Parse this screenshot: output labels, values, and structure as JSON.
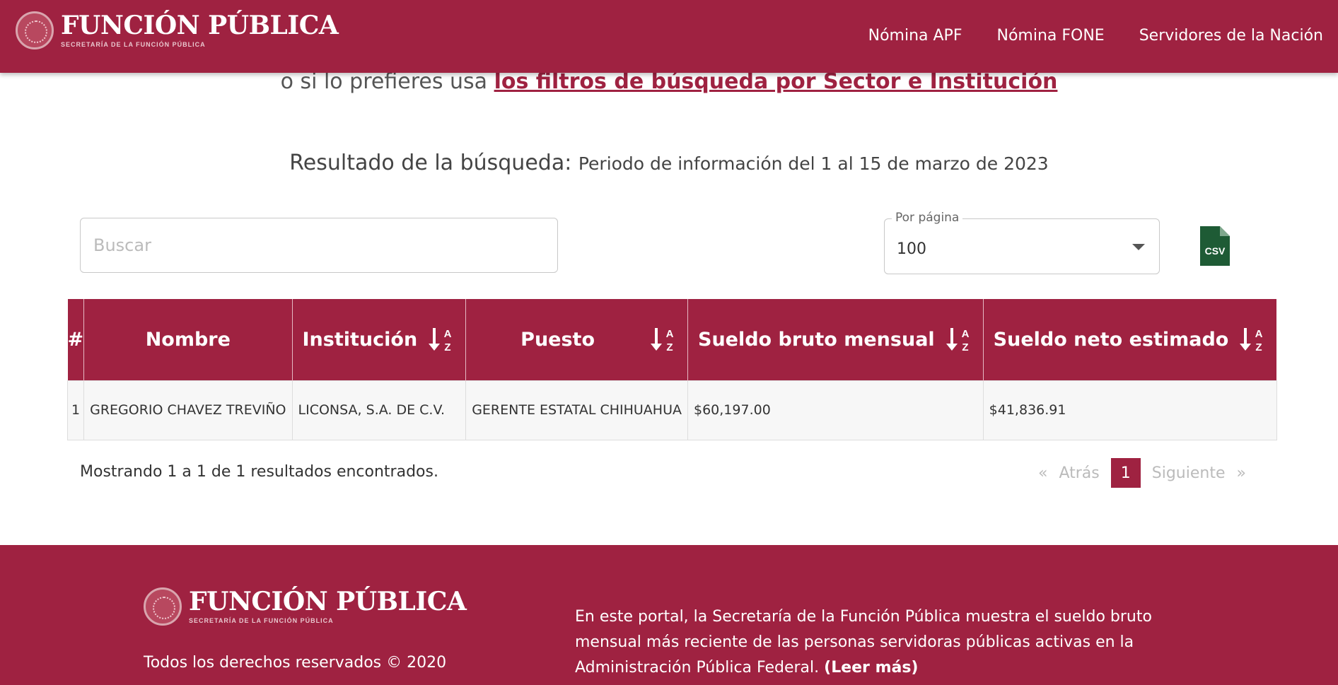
{
  "header": {
    "brand_title": "FUNCIÓN PÚBLICA",
    "brand_subtitle": "SECRETARÍA DE LA FUNCIÓN PÚBLICA",
    "nav": [
      "Nómina APF",
      "Nómina FONE",
      "Servidores de la Nación"
    ]
  },
  "main": {
    "alt_prefix": "o si lo prefieres usa ",
    "alt_link": "los filtros de búsqueda por Sector e Institución",
    "result_label": "Resultado de la búsqueda: ",
    "result_period": "Periodo de información del 1 al 15 de marzo de 2023",
    "search_placeholder": "Buscar",
    "search_value": "",
    "per_page_label": "Por página",
    "per_page_value": "100",
    "csv_icon_text": "CSV"
  },
  "table": {
    "headers": [
      "#",
      "Nombre",
      "Institución",
      "Puesto",
      "Sueldo bruto mensual",
      "Sueldo neto estimado"
    ],
    "rows": [
      [
        "1",
        "GREGORIO CHAVEZ TREVIÑO",
        "LICONSA, S.A. DE C.V.",
        "GERENTE ESTATAL CHIHUAHUA",
        "$60,197.00",
        "$41,836.91"
      ]
    ]
  },
  "pagination": {
    "summary": "Mostrando 1 a 1 de 1 resultados encontrados.",
    "first": "«",
    "prev": "Atrás",
    "current": "1",
    "next": "Siguiente",
    "last": "»"
  },
  "footer": {
    "brand_title": "FUNCIÓN PÚBLICA",
    "brand_subtitle": "SECRETARÍA DE LA FUNCIÓN PÚBLICA",
    "copyright": "Todos los derechos reservados © 2020",
    "description": "En este portal, la Secretaría de la Función Pública muestra el sueldo bruto mensual más reciente de las personas servidoras públicas activas en la Administración Pública Federal. ",
    "read_more": "(Leer más)"
  },
  "colors": {
    "brand": "#9f2241",
    "csv_green": "#1e5b35"
  }
}
